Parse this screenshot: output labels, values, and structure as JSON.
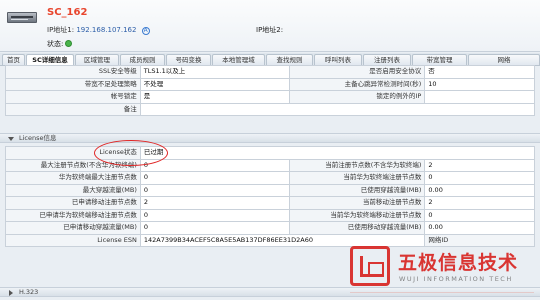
{
  "device": {
    "name": "SC_162",
    "ip1_label": "IP地址1:",
    "ip1_value": "192.168.107.162",
    "ip2_label": "IP地址2:",
    "status_label": "状态:",
    "info_icon": "info-circle-icon",
    "status_icon": "green-dot-icon",
    "device_icon": "device-icon"
  },
  "tabs": [
    "首页",
    "SC详细信息",
    "区域管理",
    "成员规则",
    "号码变换",
    "本地管理域",
    "查找规则",
    "呼叫列表",
    "注册列表",
    "带宽管理",
    "网络"
  ],
  "top_rows": [
    {
      "l1": "SSL安全等级",
      "v1": "TLS1.1以及上",
      "l2": "是否启用安全协议",
      "v2": "否"
    },
    {
      "l1": "带宽不足处理策略",
      "v1": "不处理",
      "l2": "主备心跳异常检测时间(秒)",
      "v2": "10"
    },
    {
      "l1": "帐号锁定",
      "v1": "是",
      "l2": "锁定的例外的IP",
      "v2": ""
    },
    {
      "l1": "备注",
      "v1": "",
      "l2": "",
      "v2": ""
    }
  ],
  "license": {
    "title": "License信息",
    "status_label": "License状态",
    "status_value": "已过期",
    "rows": [
      {
        "l1": "最大注册节点数(不含华为软终端)",
        "v1": "0",
        "l2": "当前注册节点数(不含华为软终端)",
        "v2": "2"
      },
      {
        "l1": "华为软终端最大注册节点数",
        "v1": "0",
        "l2": "当前华为软终端注册节点数",
        "v2": "0"
      },
      {
        "l1": "最大穿越流量(MB)",
        "v1": "0",
        "l2": "已使用穿越流量(MB)",
        "v2": "0.00"
      },
      {
        "l1": "已申请移动注册节点数",
        "v1": "2",
        "l2": "当前移动注册节点数",
        "v2": "2"
      },
      {
        "l1": "已申请华为软终端移动注册节点数",
        "v1": "0",
        "l2": "当前华为软终端移动注册节点数",
        "v2": "0"
      },
      {
        "l1": "已申请移动穿越流量(MB)",
        "v1": "0",
        "l2": "已使用移动穿越流量(MB)",
        "v2": "0.00"
      }
    ],
    "esn_label": "License ESN",
    "esn_value": "142A7399B34ACEF5C8A5E5AB137DF86EE31D2A60",
    "esn_right_label": "网络ID"
  },
  "h323": {
    "title": "H.323"
  },
  "watermark": {
    "cn": "五极信息技术",
    "en": "WUJI INFORMATION TECH"
  },
  "colors": {
    "accent": "#e8452d",
    "highlight": "#e02525",
    "status_ok": "#49b44b"
  }
}
